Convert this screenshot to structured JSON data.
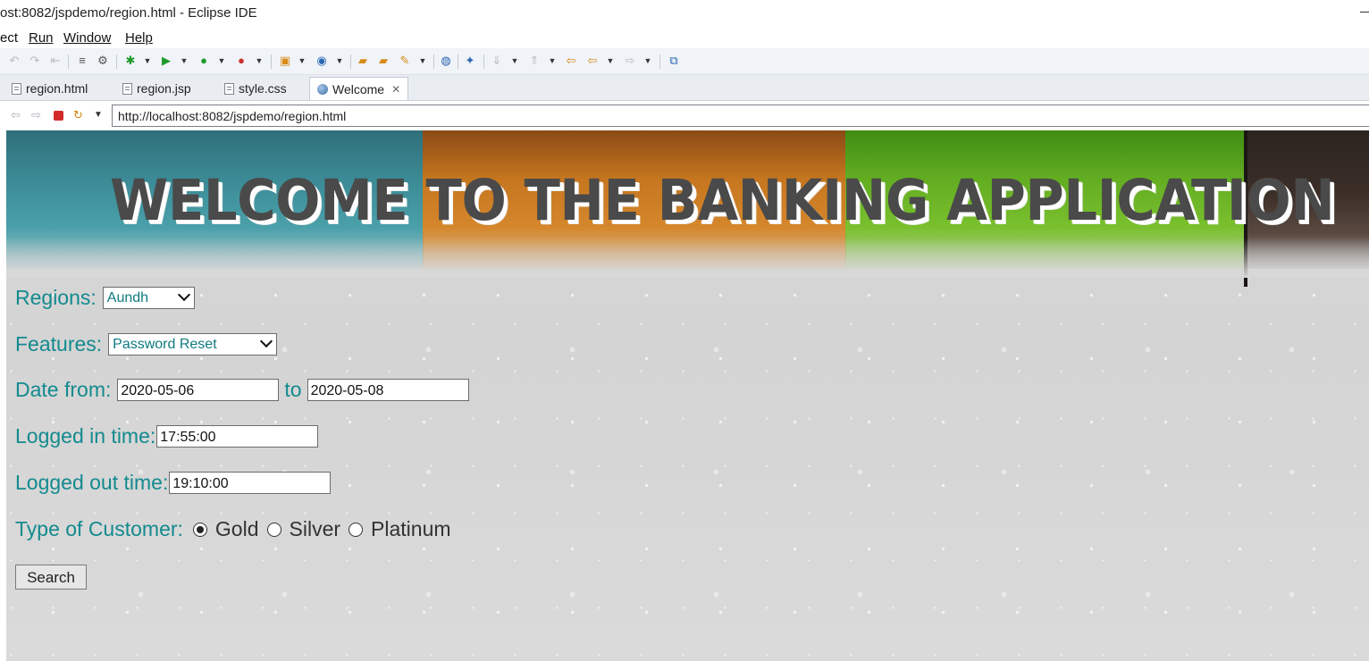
{
  "window": {
    "title": "ost:8082/jspdemo/region.html - Eclipse IDE"
  },
  "menu": {
    "items": [
      "ect",
      "Run",
      "Window",
      "Help"
    ]
  },
  "toolbar": {
    "icons": [
      "undo-icon",
      "redo-icon",
      "last-edit-icon",
      "toggle-block-icon",
      "annotation-icon",
      "debug-icon",
      "run-icon",
      "coverage-icon",
      "external-tools-icon",
      "new-server-icon",
      "new-class-icon",
      "open-type-icon",
      "open-task-icon",
      "search-icon",
      "web-browser-icon",
      "toggle-web-icon",
      "next-annotation-icon",
      "prev-annotation-icon",
      "last-edit-location-icon",
      "back-icon",
      "forward-icon",
      "open-perspective-icon"
    ]
  },
  "tabs": [
    {
      "label": "region.html",
      "icon": "file-icon",
      "active": false
    },
    {
      "label": "region.jsp",
      "icon": "file-icon",
      "active": false
    },
    {
      "label": "style.css",
      "icon": "file-icon",
      "active": false
    },
    {
      "label": "Welcome",
      "icon": "globe-icon",
      "active": true
    }
  ],
  "browser": {
    "url": "http://localhost:8082/jspdemo/region.html"
  },
  "page": {
    "banner_title": "WELCOME TO THE BANKING APPLICATION",
    "regions_label": "Regions:",
    "regions_value": "Aundh",
    "features_label": "Features:",
    "features_value": "Password Reset",
    "date_from_label": "Date from:",
    "date_from_value": "2020-05-06",
    "to_label": "to",
    "date_to_value": "2020-05-08",
    "logged_in_label": "Logged in time:",
    "logged_in_value": "17:55:00",
    "logged_out_label": "Logged out time:",
    "logged_out_value": "19:10:00",
    "customer_label": "Type of Customer:",
    "customer_options": [
      "Gold",
      "Silver",
      "Platinum"
    ],
    "customer_selected": "Gold",
    "search_label": "Search",
    "colors": {
      "label_teal": "#138a8f",
      "band_teal": "#3b8a95",
      "band_orange": "#c5761f",
      "band_green": "#63ad22",
      "band_brown": "#3b2e27"
    }
  }
}
